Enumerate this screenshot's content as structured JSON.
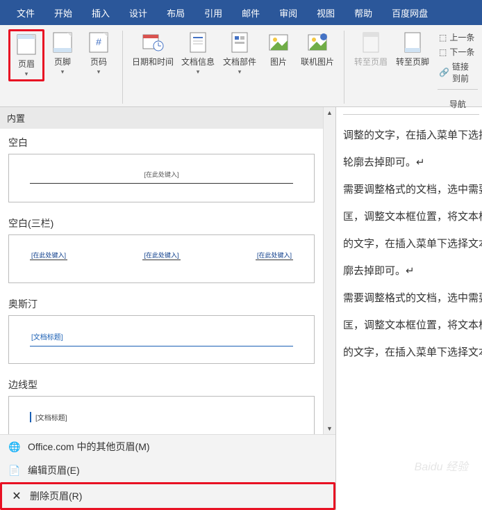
{
  "menubar": {
    "items": [
      "文件",
      "开始",
      "插入",
      "设计",
      "布局",
      "引用",
      "邮件",
      "审阅",
      "视图",
      "帮助",
      "百度网盘"
    ]
  },
  "ribbon": {
    "header_btn": "页眉",
    "footer_btn": "页脚",
    "pagenum_btn": "页码",
    "datetime_btn": "日期和时间",
    "docinfo_btn": "文档信息",
    "docparts_btn": "文档部件",
    "picture_btn": "图片",
    "onlinepic_btn": "联机图片",
    "goto_header": "转至页眉",
    "goto_footer": "转至页脚",
    "prev": "上一条",
    "next": "下一条",
    "link_prev": "链接到前",
    "nav_label": "导航"
  },
  "gallery": {
    "builtin_header": "内置",
    "blank_name": "空白",
    "blank_placeholder": "[在此处键入]",
    "blank3_name": "空白(三栏)",
    "blank3_ph1": "[在此处键入]",
    "blank3_ph2": "[在此处键入]",
    "blank3_ph3": "[在此处键入]",
    "austin_name": "奥斯汀",
    "austin_title": "[文档标题]",
    "edge_name": "边线型",
    "edge_title": "[文档标题]"
  },
  "menu": {
    "more_office": "Office.com 中的其他页眉(M)",
    "edit_header": "编辑页眉(E)",
    "remove_header": "删除页眉(R)"
  },
  "doc": {
    "l1": "调整的文字，在插入菜单下选择",
    "l2": "轮廓去掉即可。↵",
    "l3": "需要调整格式的文档，选中需要",
    "l4": "匡，调整文本框位置，将文本框",
    "l5": "的文字，在插入菜单下选择文本",
    "l6": "廓去掉即可。↵",
    "l7": "需要调整格式的文档，选中需要",
    "l8": "匡，调整文本框位置，将文本框",
    "l9": "的文字，在插入菜单下选择文本"
  },
  "watermark": "Baidu 经验"
}
